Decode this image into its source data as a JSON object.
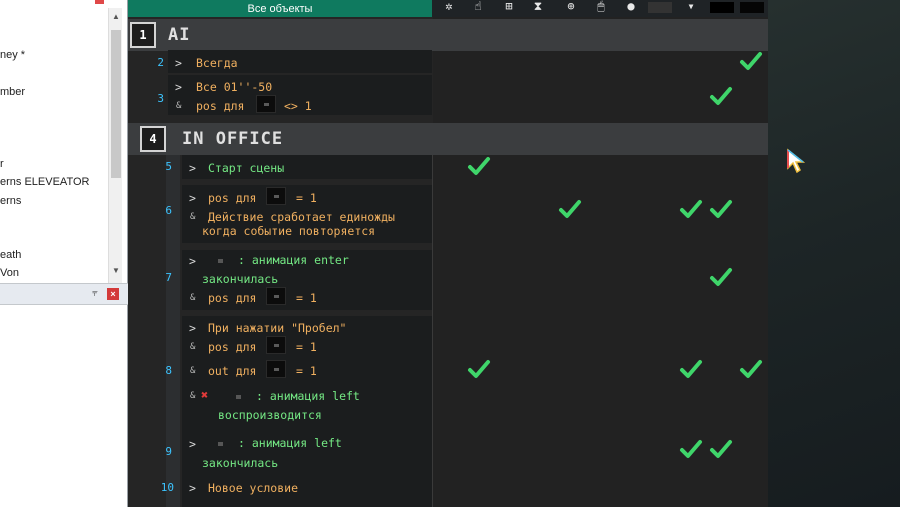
{
  "left_panel": {
    "items": [
      {
        "label": "ney *"
      },
      {
        "label": "mber"
      },
      {
        "label": "r"
      },
      {
        "label": "erns ELEVEATOR"
      },
      {
        "label": "erns"
      },
      {
        "label": "eath"
      },
      {
        "label": "Von"
      }
    ],
    "pin_glyph": "⫧",
    "close_glyph": "×"
  },
  "toolbar": {
    "objects_tab_label": "Все объекты",
    "icons": [
      "gear-icon",
      "cursor-pointer-icon",
      "grid-icon",
      "hourglass-icon",
      "add-layer-icon",
      "mouse-icon",
      "user-icon",
      "object-thumbnail-icon",
      "dropdown-icon",
      "dark-thumbnail-icon"
    ]
  },
  "sheet": {
    "groups": [
      {
        "num": "1",
        "title": "AI"
      },
      {
        "num": "4",
        "title": "IN OFFICE"
      }
    ],
    "events": {
      "e2": {
        "num": "2",
        "cond": "Всегда"
      },
      "e3": {
        "num": "3",
        "cond1": "Все 01''-50",
        "cond2": "pos для",
        "cond2_tail": "<> 1"
      },
      "e5": {
        "num": "5",
        "cond": "Старт сцены"
      },
      "e6": {
        "num": "6",
        "cond1": "pos для",
        "cond1_tail": "= 1",
        "cond2_line1": "Действие сработает единожды",
        "cond2_line2": "когда событие повторяется"
      },
      "e7": {
        "num": "7",
        "cond1_line1": ": анимация enter",
        "cond1_line2": "закончилась",
        "cond2": "pos для",
        "cond2_tail": "= 1"
      },
      "e8": {
        "num": "8",
        "cond1": "При нажатии \"Пробел\"",
        "cond2": "pos для",
        "cond2_tail": "= 1",
        "cond3": "out для",
        "cond3_tail": "= 1",
        "cond4_line1": ": анимация left",
        "cond4_line2": "воспроизводится",
        "cond4_invert": "✖"
      },
      "e9": {
        "num": "9",
        "cond1_line1": ": анимация left",
        "cond1_line2": "закончилась"
      },
      "e10": {
        "num": "10",
        "cond": "Новое условие"
      }
    },
    "gt": ">",
    "amp": "&"
  },
  "colors": {
    "accent_tab": "#0f7a5f",
    "event_number": "#3cc4ff",
    "check": "#3fd56a",
    "invert_x": "#e23a3a"
  }
}
